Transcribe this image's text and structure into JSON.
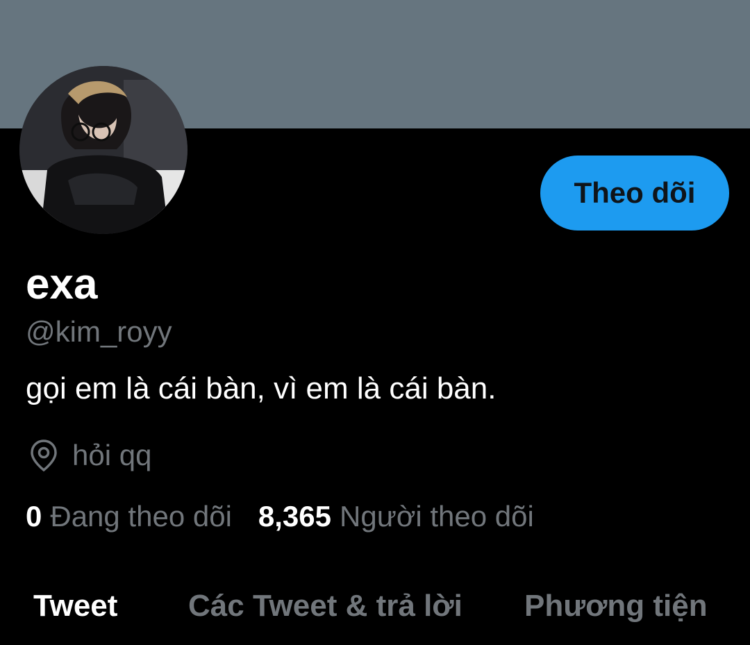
{
  "profile": {
    "display_name": "exa",
    "handle": "@kim_royy",
    "bio": "gọi em là cái bàn, vì em là cái bàn.",
    "location": "hỏi qq",
    "banner_color": "#66757f"
  },
  "actions": {
    "follow_label": "Theo dõi",
    "follow_color": "#1d9bf0"
  },
  "stats": {
    "following_count": "0",
    "following_label": "Đang theo dõi",
    "followers_count": "8,365",
    "followers_label": "Người theo dõi"
  },
  "tabs": [
    {
      "label": "Tweet",
      "active": true
    },
    {
      "label": "Các Tweet & trả lời",
      "active": false
    },
    {
      "label": "Phương tiện",
      "active": false
    }
  ],
  "icons": {
    "location": "location-pin-icon"
  }
}
